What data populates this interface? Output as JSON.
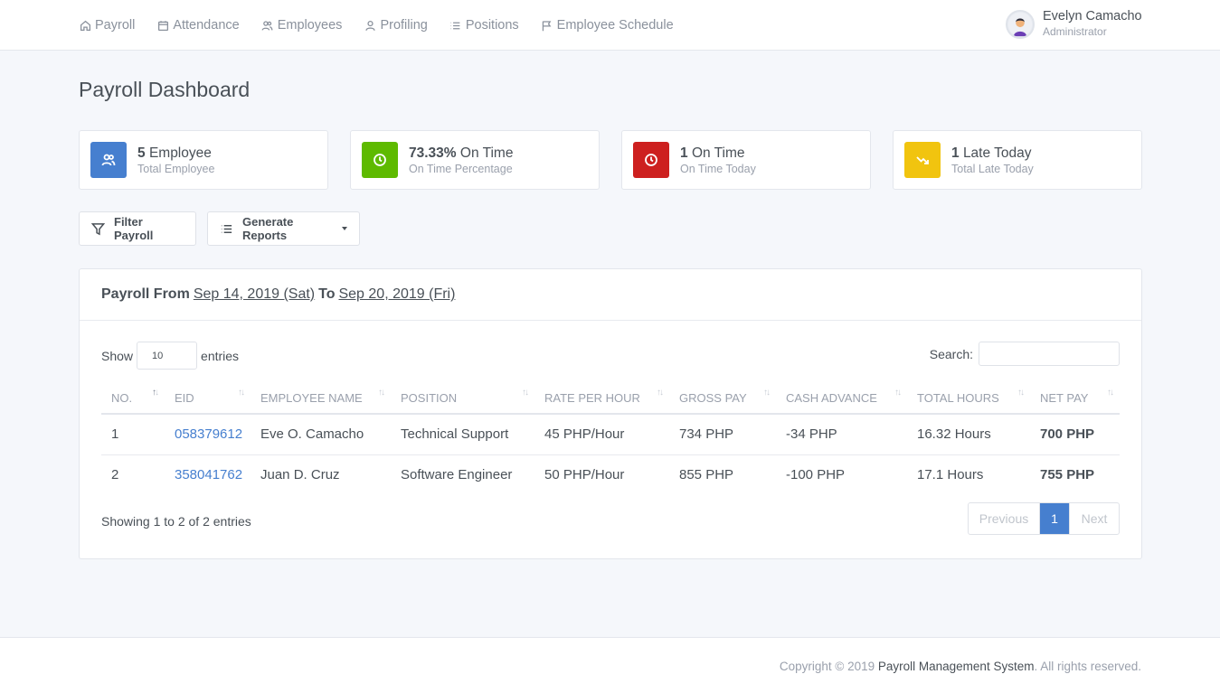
{
  "nav": {
    "items": [
      {
        "label": "Payroll",
        "icon": "home-icon"
      },
      {
        "label": "Attendance",
        "icon": "calendar-icon"
      },
      {
        "label": "Employees",
        "icon": "users-icon"
      },
      {
        "label": "Profiling",
        "icon": "user-icon"
      },
      {
        "label": "Positions",
        "icon": "list-icon"
      },
      {
        "label": "Employee Schedule",
        "icon": "flag-icon"
      }
    ]
  },
  "user": {
    "name": "Evelyn Camacho",
    "role": "Administrator"
  },
  "page": {
    "title": "Payroll Dashboard"
  },
  "stats": [
    {
      "value": "5",
      "label": "Employee",
      "sub": "Total Employee",
      "color": "#467fcf",
      "icon": "users-icon"
    },
    {
      "value": "73.33%",
      "label": "On Time",
      "sub": "On Time Percentage",
      "color": "#5eba00",
      "icon": "clock-icon"
    },
    {
      "value": "1",
      "label": "On Time",
      "sub": "On Time Today",
      "color": "#cd201f",
      "icon": "clock-icon"
    },
    {
      "value": "1",
      "label": "Late Today",
      "sub": "Total Late Today",
      "color": "#f1c40f",
      "icon": "trending-down-icon"
    }
  ],
  "buttons": {
    "filter": "Filter Payroll",
    "reports": "Generate Reports"
  },
  "payroll": {
    "prefix": "Payroll From",
    "from": "Sep 14, 2019 (Sat)",
    "to_label": "To",
    "to": "Sep 20, 2019 (Fri)"
  },
  "table": {
    "show_label": "Show",
    "entries_value": "10",
    "entries_label": "entries",
    "search_label": "Search:",
    "columns": [
      "No.",
      "EID",
      "Employee Name",
      "Position",
      "Rate Per Hour",
      "Gross Pay",
      "Cash Advance",
      "Total Hours",
      "Net Pay"
    ],
    "rows": [
      [
        "1",
        "058379612",
        "Eve O. Camacho",
        "Technical Support",
        "45 PHP/Hour",
        "734 PHP",
        "-34 PHP",
        "16.32 Hours",
        "700 PHP"
      ],
      [
        "2",
        "358041762",
        "Juan D. Cruz",
        "Software Engineer",
        "50 PHP/Hour",
        "855 PHP",
        "-100 PHP",
        "17.1 Hours",
        "755 PHP"
      ]
    ],
    "info": "Showing 1 to 2 of 2 entries",
    "pager": {
      "previous": "Previous",
      "current": "1",
      "next": "Next"
    }
  },
  "footer": {
    "prefix": "Copyright © 2019",
    "brand": "Payroll Management System",
    "suffix": ". All rights reserved."
  }
}
